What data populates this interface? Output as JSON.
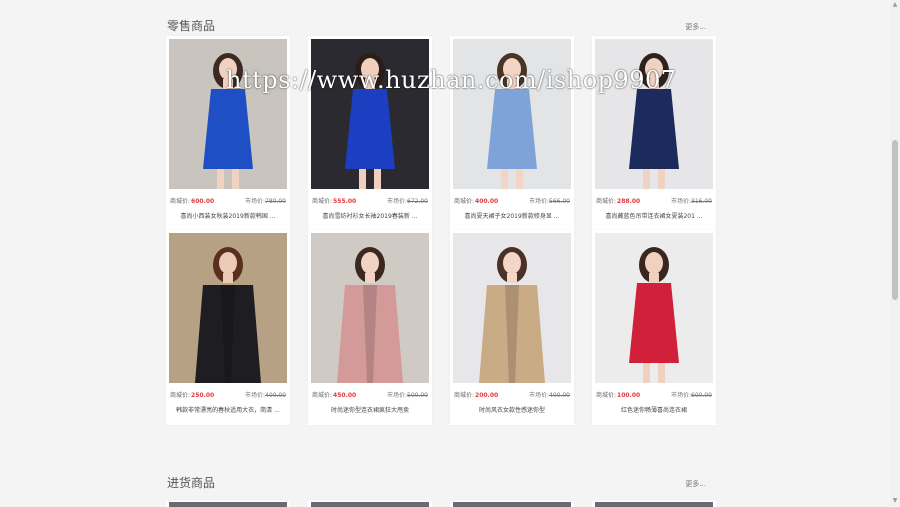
{
  "retail": {
    "title": "零售商品",
    "more": "更多...",
    "products": [
      {
        "shop_label": "商城价:",
        "shop_price": "600.00",
        "market_label": "市场价:",
        "market_price": "780.00",
        "name": "喜尚小西装女秋装2019新款韩国 ...",
        "image_icon": "dress-photo",
        "colors": {
          "bg": "#c9c4bd",
          "dress": "#1f4fc4",
          "hair": "#3a2a22",
          "skin": "#f1d2c0"
        }
      },
      {
        "shop_label": "商城价:",
        "shop_price": "555.00",
        "market_label": "市场价:",
        "market_price": "672.00",
        "name": "喜尚雪纺衬衫女长袖2019春装新 ...",
        "image_icon": "dress-photo",
        "colors": {
          "bg": "#2a2a30",
          "dress": "#1b3fc0",
          "hair": "#2b1d17",
          "skin": "#f0d0bd"
        }
      },
      {
        "shop_label": "商城价:",
        "shop_price": "400.00",
        "market_label": "市场价:",
        "market_price": "566.00",
        "name": "喜尚夏天裙子女2019新款修身显 ...",
        "image_icon": "dress-photo",
        "colors": {
          "bg": "#e2e4e6",
          "dress": "#7fa2d9",
          "hair": "#4a3426",
          "skin": "#f2d5c4"
        }
      },
      {
        "shop_label": "商城价:",
        "shop_price": "288.00",
        "market_label": "市场价:",
        "market_price": "316.00",
        "name": "喜尚藏蓝色吊带连衣裙女夏装201 ...",
        "image_icon": "dress-photo",
        "colors": {
          "bg": "#e6e6e8",
          "dress": "#1c2a5c",
          "hair": "#2e221c",
          "skin": "#f0d2c2"
        }
      }
    ]
  },
  "wholesale_row2": {
    "products": [
      {
        "shop_label": "商城价:",
        "shop_price": "250.00",
        "market_label": "市场价:",
        "market_price": "400.00",
        "name": "韩款非常漂亮的春秋适用大衣，简清 ...",
        "image_icon": "coat-photo",
        "colors": {
          "bg": "#b7a184",
          "dress": "#1d1d22",
          "hair": "#5a2e1e",
          "skin": "#eccab6"
        }
      },
      {
        "shop_label": "商城价:",
        "shop_price": "450.00",
        "market_label": "市场价:",
        "market_price": "500.00",
        "name": "时尚迷你型连衣裙疯狂大甩卖",
        "image_icon": "coat-photo",
        "colors": {
          "bg": "#cfcbc4",
          "dress": "#d49a9a",
          "hair": "#3a2820",
          "skin": "#f1d3c3"
        }
      },
      {
        "shop_label": "商城价:",
        "shop_price": "200.00",
        "market_label": "市场价:",
        "market_price": "400.00",
        "name": "时尚风衣女款性感迷你型",
        "image_icon": "coat-photo",
        "colors": {
          "bg": "#e7e7e9",
          "dress": "#c9ab86",
          "hair": "#4a3226",
          "skin": "#f3d6c7"
        }
      },
      {
        "shop_label": "商城价:",
        "shop_price": "100.00",
        "market_label": "市场价:",
        "market_price": "600.00",
        "name": "红色迷你畅薄喜尚连衣裙",
        "image_icon": "dress-photo",
        "colors": {
          "bg": "#ececec",
          "dress": "#d0203a",
          "hair": "#3a2620",
          "skin": "#f0d0be"
        }
      }
    ]
  },
  "wholesale": {
    "title": "进货商品",
    "more": "更多..."
  },
  "watermark": "https://www.huzhan.com/ishop9907"
}
